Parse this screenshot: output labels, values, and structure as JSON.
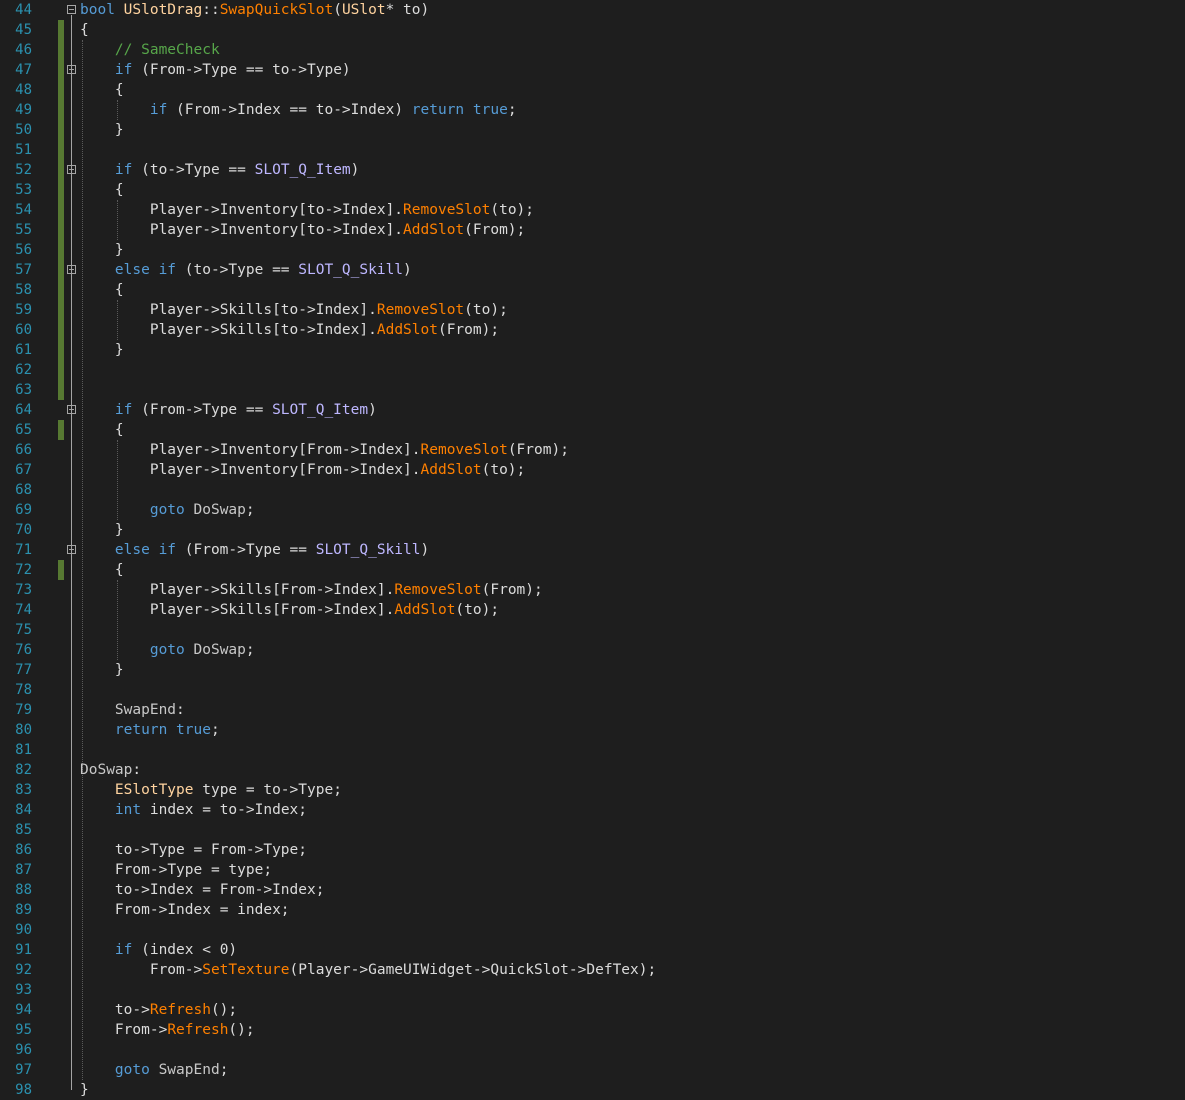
{
  "colors": {
    "background": "#1e1e1e",
    "line_number": "#2b91af",
    "default": "#dcdcdc",
    "keyword": "#569cd6",
    "comment": "#57a64a",
    "type": "#ffd39f",
    "member": "#dadada",
    "function": "#ff8000",
    "enum_constant": "#b8d7a3",
    "macro": "#beb7ff",
    "label": "#c8c8c8",
    "change_bar": "#577932",
    "fold_box": "#a5a5a5"
  },
  "lines": [
    {
      "n": "44",
      "fold": true,
      "changed": false,
      "tokens": [
        [
          "kw",
          "bool "
        ],
        [
          "type",
          "USlotDrag"
        ],
        [
          "def",
          "::"
        ],
        [
          "fn",
          "SwapQuickSlot"
        ],
        [
          "def",
          "("
        ],
        [
          "type",
          "USlot"
        ],
        [
          "def",
          "* to)"
        ]
      ]
    },
    {
      "n": "45",
      "fold": false,
      "changed": true,
      "tokens": [
        [
          "def",
          "{"
        ]
      ]
    },
    {
      "n": "46",
      "fold": false,
      "changed": true,
      "tokens": [
        [
          "def",
          "    "
        ],
        [
          "cm",
          "// SameCheck"
        ]
      ]
    },
    {
      "n": "47",
      "fold": true,
      "changed": true,
      "tokens": [
        [
          "def",
          "    "
        ],
        [
          "kw",
          "if"
        ],
        [
          "def",
          " (From->"
        ],
        [
          "mem",
          "Type"
        ],
        [
          "def",
          " == to->"
        ],
        [
          "mem",
          "Type"
        ],
        [
          "def",
          ")"
        ]
      ]
    },
    {
      "n": "48",
      "fold": false,
      "changed": true,
      "tokens": [
        [
          "def",
          "    {"
        ]
      ]
    },
    {
      "n": "49",
      "fold": false,
      "changed": true,
      "tokens": [
        [
          "def",
          "        "
        ],
        [
          "kw",
          "if"
        ],
        [
          "def",
          " (From->"
        ],
        [
          "mem",
          "Index"
        ],
        [
          "def",
          " == to->"
        ],
        [
          "mem",
          "Index"
        ],
        [
          "def",
          ") "
        ],
        [
          "kw",
          "return true"
        ],
        [
          "def",
          ";"
        ]
      ]
    },
    {
      "n": "50",
      "fold": false,
      "changed": true,
      "tokens": [
        [
          "def",
          "    }"
        ]
      ]
    },
    {
      "n": "51",
      "fold": false,
      "changed": true,
      "tokens": []
    },
    {
      "n": "52",
      "fold": true,
      "changed": true,
      "tokens": [
        [
          "def",
          "    "
        ],
        [
          "kw",
          "if"
        ],
        [
          "def",
          " (to->"
        ],
        [
          "mem",
          "Type"
        ],
        [
          "def",
          " == "
        ],
        [
          "mac",
          "SLOT_Q_Item"
        ],
        [
          "def",
          ")"
        ]
      ]
    },
    {
      "n": "53",
      "fold": false,
      "changed": true,
      "tokens": [
        [
          "def",
          "    {"
        ]
      ]
    },
    {
      "n": "54",
      "fold": false,
      "changed": true,
      "tokens": [
        [
          "def",
          "        Player->"
        ],
        [
          "mem",
          "Inventory"
        ],
        [
          "def",
          "[to->"
        ],
        [
          "mem",
          "Index"
        ],
        [
          "def",
          "]."
        ],
        [
          "fn",
          "RemoveSlot"
        ],
        [
          "def",
          "(to);"
        ]
      ]
    },
    {
      "n": "55",
      "fold": false,
      "changed": true,
      "tokens": [
        [
          "def",
          "        Player->"
        ],
        [
          "mem",
          "Inventory"
        ],
        [
          "def",
          "[to->"
        ],
        [
          "mem",
          "Index"
        ],
        [
          "def",
          "]."
        ],
        [
          "fn",
          "AddSlot"
        ],
        [
          "def",
          "(From);"
        ]
      ]
    },
    {
      "n": "56",
      "fold": false,
      "changed": true,
      "tokens": [
        [
          "def",
          "    }"
        ]
      ]
    },
    {
      "n": "57",
      "fold": true,
      "changed": true,
      "tokens": [
        [
          "def",
          "    "
        ],
        [
          "kw",
          "else if"
        ],
        [
          "def",
          " (to->"
        ],
        [
          "mem",
          "Type"
        ],
        [
          "def",
          " == "
        ],
        [
          "mac",
          "SLOT_Q_Skill"
        ],
        [
          "def",
          ")"
        ]
      ]
    },
    {
      "n": "58",
      "fold": false,
      "changed": true,
      "tokens": [
        [
          "def",
          "    {"
        ]
      ]
    },
    {
      "n": "59",
      "fold": false,
      "changed": true,
      "tokens": [
        [
          "def",
          "        Player->"
        ],
        [
          "mem",
          "Skills"
        ],
        [
          "def",
          "[to->"
        ],
        [
          "mem",
          "Index"
        ],
        [
          "def",
          "]."
        ],
        [
          "fn",
          "RemoveSlot"
        ],
        [
          "def",
          "(to);"
        ]
      ]
    },
    {
      "n": "60",
      "fold": false,
      "changed": true,
      "tokens": [
        [
          "def",
          "        Player->"
        ],
        [
          "mem",
          "Skills"
        ],
        [
          "def",
          "[to->"
        ],
        [
          "mem",
          "Index"
        ],
        [
          "def",
          "]."
        ],
        [
          "fn",
          "AddSlot"
        ],
        [
          "def",
          "(From);"
        ]
      ]
    },
    {
      "n": "61",
      "fold": false,
      "changed": true,
      "tokens": [
        [
          "def",
          "    }"
        ]
      ]
    },
    {
      "n": "62",
      "fold": false,
      "changed": true,
      "tokens": []
    },
    {
      "n": "63",
      "fold": false,
      "changed": true,
      "tokens": []
    },
    {
      "n": "64",
      "fold": true,
      "changed": false,
      "tokens": [
        [
          "def",
          "    "
        ],
        [
          "kw",
          "if"
        ],
        [
          "def",
          " (From->"
        ],
        [
          "mem",
          "Type"
        ],
        [
          "def",
          " == "
        ],
        [
          "mac",
          "SLOT_Q_Item"
        ],
        [
          "def",
          ")"
        ]
      ]
    },
    {
      "n": "65",
      "fold": false,
      "changed": true,
      "tokens": [
        [
          "def",
          "    {"
        ]
      ]
    },
    {
      "n": "66",
      "fold": false,
      "changed": false,
      "tokens": [
        [
          "def",
          "        Player->"
        ],
        [
          "mem",
          "Inventory"
        ],
        [
          "def",
          "[From->"
        ],
        [
          "mem",
          "Index"
        ],
        [
          "def",
          "]."
        ],
        [
          "fn",
          "RemoveSlot"
        ],
        [
          "def",
          "(From);"
        ]
      ]
    },
    {
      "n": "67",
      "fold": false,
      "changed": false,
      "tokens": [
        [
          "def",
          "        Player->"
        ],
        [
          "mem",
          "Inventory"
        ],
        [
          "def",
          "[From->"
        ],
        [
          "mem",
          "Index"
        ],
        [
          "def",
          "]."
        ],
        [
          "fn",
          "AddSlot"
        ],
        [
          "def",
          "(to);"
        ]
      ]
    },
    {
      "n": "68",
      "fold": false,
      "changed": false,
      "tokens": []
    },
    {
      "n": "69",
      "fold": false,
      "changed": false,
      "tokens": [
        [
          "def",
          "        "
        ],
        [
          "kw",
          "goto"
        ],
        [
          "def",
          " "
        ],
        [
          "lbl",
          "DoSwap"
        ],
        [
          "def",
          ";"
        ]
      ]
    },
    {
      "n": "70",
      "fold": false,
      "changed": false,
      "tokens": [
        [
          "def",
          "    }"
        ]
      ]
    },
    {
      "n": "71",
      "fold": true,
      "changed": false,
      "tokens": [
        [
          "def",
          "    "
        ],
        [
          "kw",
          "else if"
        ],
        [
          "def",
          " (From->"
        ],
        [
          "mem",
          "Type"
        ],
        [
          "def",
          " == "
        ],
        [
          "mac",
          "SLOT_Q_Skill"
        ],
        [
          "def",
          ")"
        ]
      ]
    },
    {
      "n": "72",
      "fold": false,
      "changed": true,
      "tokens": [
        [
          "def",
          "    {"
        ]
      ]
    },
    {
      "n": "73",
      "fold": false,
      "changed": false,
      "tokens": [
        [
          "def",
          "        Player->"
        ],
        [
          "mem",
          "Skills"
        ],
        [
          "def",
          "[From->"
        ],
        [
          "mem",
          "Index"
        ],
        [
          "def",
          "]."
        ],
        [
          "fn",
          "RemoveSlot"
        ],
        [
          "def",
          "(From);"
        ]
      ]
    },
    {
      "n": "74",
      "fold": false,
      "changed": false,
      "tokens": [
        [
          "def",
          "        Player->"
        ],
        [
          "mem",
          "Skills"
        ],
        [
          "def",
          "[From->"
        ],
        [
          "mem",
          "Index"
        ],
        [
          "def",
          "]."
        ],
        [
          "fn",
          "AddSlot"
        ],
        [
          "def",
          "(to);"
        ]
      ]
    },
    {
      "n": "75",
      "fold": false,
      "changed": false,
      "tokens": []
    },
    {
      "n": "76",
      "fold": false,
      "changed": false,
      "tokens": [
        [
          "def",
          "        "
        ],
        [
          "kw",
          "goto"
        ],
        [
          "def",
          " "
        ],
        [
          "lbl",
          "DoSwap"
        ],
        [
          "def",
          ";"
        ]
      ]
    },
    {
      "n": "77",
      "fold": false,
      "changed": false,
      "tokens": [
        [
          "def",
          "    }"
        ]
      ]
    },
    {
      "n": "78",
      "fold": false,
      "changed": false,
      "tokens": []
    },
    {
      "n": "79",
      "fold": false,
      "changed": false,
      "tokens": [
        [
          "def",
          "    "
        ],
        [
          "lbl",
          "SwapEnd"
        ],
        [
          "def",
          ":"
        ]
      ]
    },
    {
      "n": "80",
      "fold": false,
      "changed": false,
      "tokens": [
        [
          "def",
          "    "
        ],
        [
          "kw",
          "return true"
        ],
        [
          "def",
          ";"
        ]
      ]
    },
    {
      "n": "81",
      "fold": false,
      "changed": false,
      "tokens": []
    },
    {
      "n": "82",
      "fold": false,
      "changed": false,
      "tokens": [
        [
          "lbl",
          "DoSwap"
        ],
        [
          "def",
          ":"
        ]
      ]
    },
    {
      "n": "83",
      "fold": false,
      "changed": false,
      "tokens": [
        [
          "def",
          "    "
        ],
        [
          "type",
          "ESlotType"
        ],
        [
          "def",
          " type = to->"
        ],
        [
          "mem",
          "Type"
        ],
        [
          "def",
          ";"
        ]
      ]
    },
    {
      "n": "84",
      "fold": false,
      "changed": false,
      "tokens": [
        [
          "def",
          "    "
        ],
        [
          "kw",
          "int"
        ],
        [
          "def",
          " index = to->"
        ],
        [
          "mem",
          "Index"
        ],
        [
          "def",
          ";"
        ]
      ]
    },
    {
      "n": "85",
      "fold": false,
      "changed": false,
      "tokens": []
    },
    {
      "n": "86",
      "fold": false,
      "changed": false,
      "tokens": [
        [
          "def",
          "    to->"
        ],
        [
          "mem",
          "Type"
        ],
        [
          "def",
          " = From->"
        ],
        [
          "mem",
          "Type"
        ],
        [
          "def",
          ";"
        ]
      ]
    },
    {
      "n": "87",
      "fold": false,
      "changed": false,
      "tokens": [
        [
          "def",
          "    From->"
        ],
        [
          "mem",
          "Type"
        ],
        [
          "def",
          " = type;"
        ]
      ]
    },
    {
      "n": "88",
      "fold": false,
      "changed": false,
      "tokens": [
        [
          "def",
          "    to->"
        ],
        [
          "mem",
          "Index"
        ],
        [
          "def",
          " = From->"
        ],
        [
          "mem",
          "Index"
        ],
        [
          "def",
          ";"
        ]
      ]
    },
    {
      "n": "89",
      "fold": false,
      "changed": false,
      "tokens": [
        [
          "def",
          "    From->"
        ],
        [
          "mem",
          "Index"
        ],
        [
          "def",
          " = index;"
        ]
      ]
    },
    {
      "n": "90",
      "fold": false,
      "changed": false,
      "tokens": []
    },
    {
      "n": "91",
      "fold": false,
      "changed": false,
      "tokens": [
        [
          "def",
          "    "
        ],
        [
          "kw",
          "if"
        ],
        [
          "def",
          " (index < 0)"
        ]
      ]
    },
    {
      "n": "92",
      "fold": false,
      "changed": false,
      "tokens": [
        [
          "def",
          "        From->"
        ],
        [
          "fn",
          "SetTexture"
        ],
        [
          "def",
          "(Player->"
        ],
        [
          "mem",
          "GameUIWidget"
        ],
        [
          "def",
          "->"
        ],
        [
          "mem",
          "QuickSlot"
        ],
        [
          "def",
          "->"
        ],
        [
          "mem",
          "DefTex"
        ],
        [
          "def",
          ");"
        ]
      ]
    },
    {
      "n": "93",
      "fold": false,
      "changed": false,
      "tokens": []
    },
    {
      "n": "94",
      "fold": false,
      "changed": false,
      "tokens": [
        [
          "def",
          "    to->"
        ],
        [
          "fn",
          "Refresh"
        ],
        [
          "def",
          "();"
        ]
      ]
    },
    {
      "n": "95",
      "fold": false,
      "changed": false,
      "tokens": [
        [
          "def",
          "    From->"
        ],
        [
          "fn",
          "Refresh"
        ],
        [
          "def",
          "();"
        ]
      ]
    },
    {
      "n": "96",
      "fold": false,
      "changed": false,
      "tokens": []
    },
    {
      "n": "97",
      "fold": false,
      "changed": false,
      "tokens": [
        [
          "def",
          "    "
        ],
        [
          "kw",
          "goto"
        ],
        [
          "def",
          " "
        ],
        [
          "lbl",
          "SwapEnd"
        ],
        [
          "def",
          ";"
        ]
      ]
    },
    {
      "n": "98",
      "fold": false,
      "changed": false,
      "tokens": [
        [
          "def",
          "}"
        ]
      ]
    }
  ]
}
